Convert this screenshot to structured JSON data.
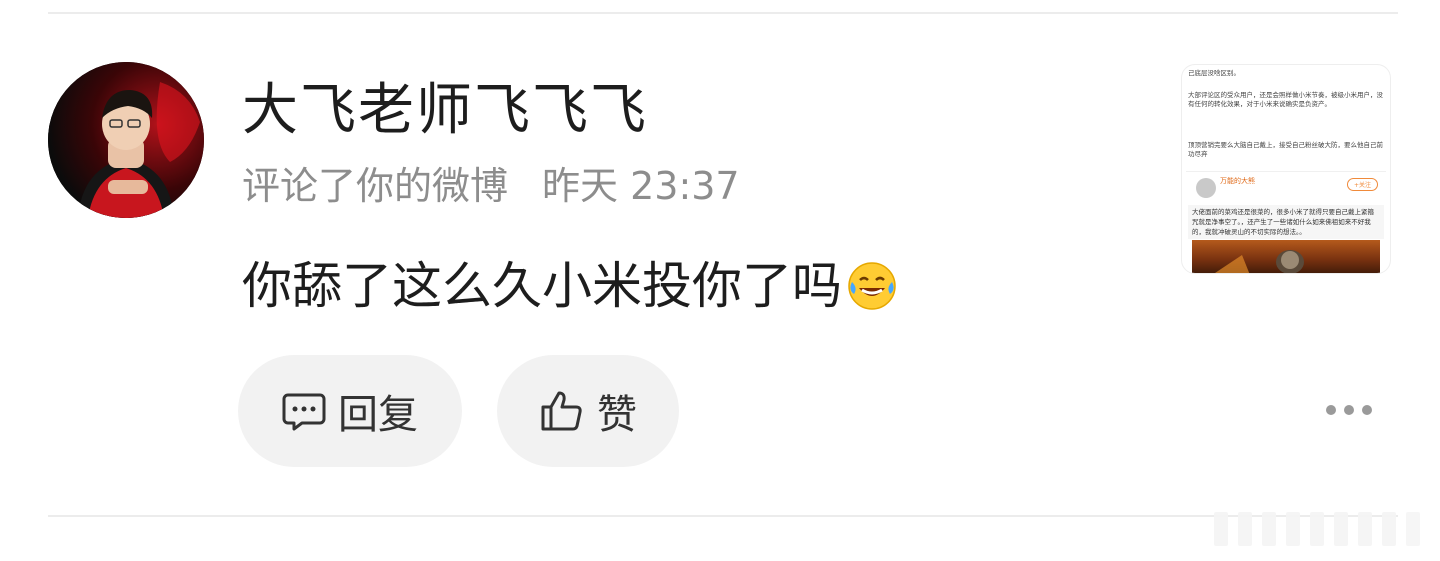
{
  "user": {
    "name": "大飞老师飞飞飞"
  },
  "notification": {
    "action": "评论了你的微博",
    "time": "昨天 23:37"
  },
  "comment": {
    "text": "你舔了这么久小米投你了吗",
    "emoji_icon": "laughing-tears-emoji"
  },
  "actions": {
    "reply_label": "回复",
    "reply_icon": "comment-bubble-icon",
    "like_label": "赞",
    "like_icon": "thumbs-up-icon",
    "more_icon": "more-dots-icon"
  },
  "thumbnail": {
    "line1": "己底层没啥区别。",
    "line2": "大部评论区的受众用户，还是会照样做小米节奏，被级小米用户，没有任何的转化效果，对于小米来说确实是负资产。",
    "line3": "顶顶营销完要么大脑自己戴上，接受自己粉丝破大防，要么他自己前功尽弃",
    "quote_name": "万能的大熊",
    "quote_follow": "+关注",
    "quote_text": "大佬面前的菜鸡还是很菜的，很多小米了就得只要自己戴上紧箍咒就是净事空了。，还产生了一些诸如什么如来佛祖如来不好我的，我就冲破灵山的不切实际的想法。。"
  },
  "colors": {
    "text_primary": "#1d1d1d",
    "text_secondary": "#8d8d8d",
    "button_bg": "#f2f2f2"
  }
}
